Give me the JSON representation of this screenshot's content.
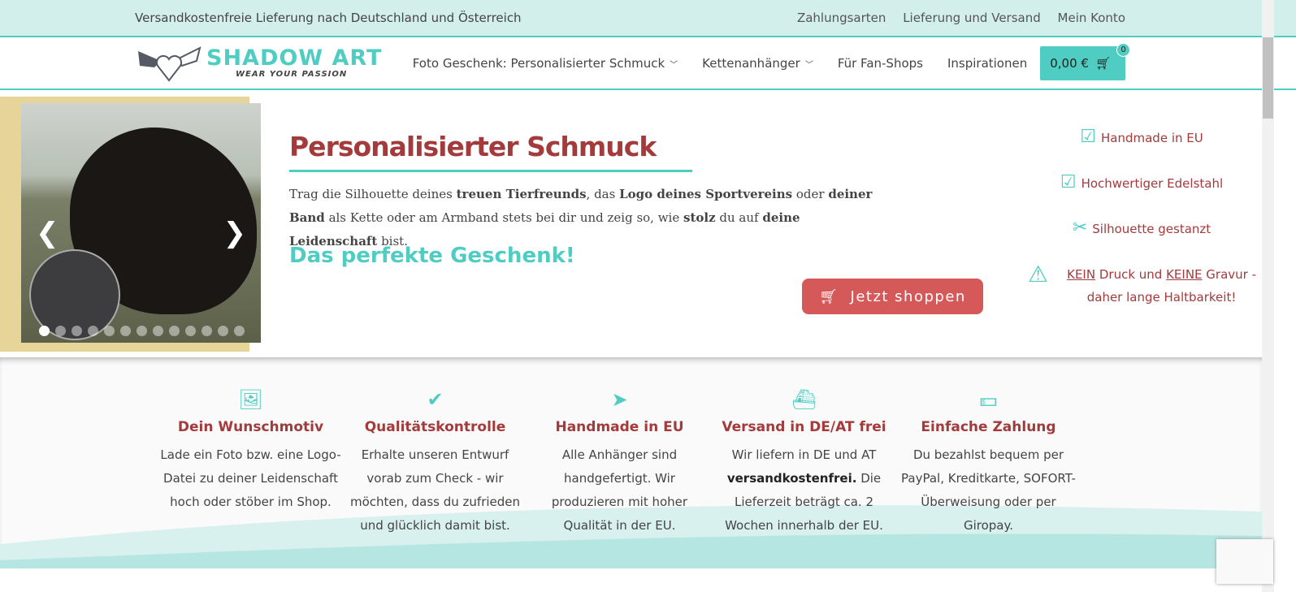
{
  "topbar": {
    "notice": "Versandkostenfreie Lieferung nach Deutschland und Österreich",
    "links": [
      "Zahlungsarten",
      "Lieferung und Versand",
      "Mein Konto"
    ]
  },
  "logo": {
    "brand": "SHADOW ART",
    "tagline": "WEAR YOUR PASSION"
  },
  "nav": {
    "items": [
      "Foto Geschenk: Personalisierter Schmuck",
      "Kettenanhänger",
      "Für Fan-Shops",
      "Inspirationen"
    ],
    "cart_total": "0,00 €",
    "cart_count": "0"
  },
  "hero": {
    "title": "Personalisierter Schmuck",
    "text_parts": [
      "Trag die Silhouette deines ",
      "treuen Tierfreunds",
      ", das ",
      "Logo deines Sportvereins",
      " oder ",
      "deiner Band",
      " als Kette oder am Armband stets bei dir und zeig so, wie ",
      "stolz",
      " du auf ",
      "deine Leidenschaft",
      " bist."
    ],
    "subtitle": "Das perfekte Geschenk!",
    "cta": "Jetzt shoppen",
    "slide_count": 13,
    "active_slide": 1
  },
  "features": {
    "f1": "Handmade in EU",
    "f2": "Hochwertiger Edelstahl",
    "f3": "Silhouette gestanzt",
    "f4a": "KEIN",
    "f4b": " Druck und ",
    "f4c": "KEINE",
    "f4d": " Gravur - daher lange Haltbarkeit!"
  },
  "benefits": [
    {
      "title": "Dein Wunschmotiv",
      "text": "Lade ein Foto bzw. eine Logo-Datei zu deiner Leidenschaft hoch oder stöber im Shop."
    },
    {
      "title": "Qualitätskontrolle",
      "text": "Erhalte unseren Entwurf vorab zum Check - wir möchten, dass du zufrieden und glücklich damit bist."
    },
    {
      "title": "Handmade in EU",
      "text": "Alle Anhänger sind handgefertigt. Wir produzieren mit hoher Qualität in der EU."
    },
    {
      "title": "Versand in DE/AT frei",
      "text_a": "Wir liefern in DE und AT ",
      "text_b": "versandkostenfrei.",
      "text_c": " Die Lieferzeit beträgt ca. 2 Wochen innerhalb der EU."
    },
    {
      "title": "Einfache Zahlung",
      "text": "Du bezahlst bequem per PayPal, Kreditkarte, SOFORT-Überweisung oder per Giropay."
    }
  ]
}
